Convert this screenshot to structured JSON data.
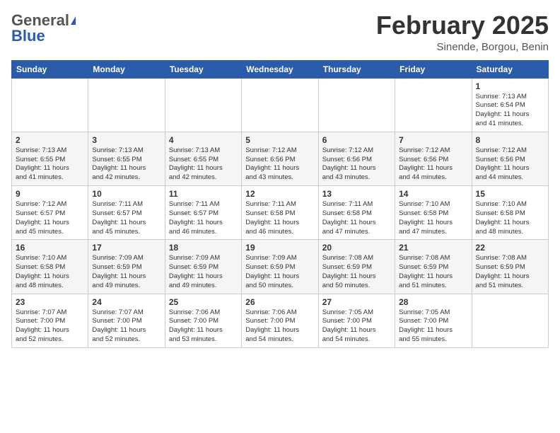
{
  "header": {
    "logo_general": "General",
    "logo_blue": "Blue",
    "month_title": "February 2025",
    "location": "Sinende, Borgou, Benin"
  },
  "calendar": {
    "days_of_week": [
      "Sunday",
      "Monday",
      "Tuesday",
      "Wednesday",
      "Thursday",
      "Friday",
      "Saturday"
    ],
    "weeks": [
      [
        {
          "day": "",
          "info": ""
        },
        {
          "day": "",
          "info": ""
        },
        {
          "day": "",
          "info": ""
        },
        {
          "day": "",
          "info": ""
        },
        {
          "day": "",
          "info": ""
        },
        {
          "day": "",
          "info": ""
        },
        {
          "day": "1",
          "info": "Sunrise: 7:13 AM\nSunset: 6:54 PM\nDaylight: 11 hours\nand 41 minutes."
        }
      ],
      [
        {
          "day": "2",
          "info": "Sunrise: 7:13 AM\nSunset: 6:55 PM\nDaylight: 11 hours\nand 41 minutes."
        },
        {
          "day": "3",
          "info": "Sunrise: 7:13 AM\nSunset: 6:55 PM\nDaylight: 11 hours\nand 42 minutes."
        },
        {
          "day": "4",
          "info": "Sunrise: 7:13 AM\nSunset: 6:55 PM\nDaylight: 11 hours\nand 42 minutes."
        },
        {
          "day": "5",
          "info": "Sunrise: 7:12 AM\nSunset: 6:56 PM\nDaylight: 11 hours\nand 43 minutes."
        },
        {
          "day": "6",
          "info": "Sunrise: 7:12 AM\nSunset: 6:56 PM\nDaylight: 11 hours\nand 43 minutes."
        },
        {
          "day": "7",
          "info": "Sunrise: 7:12 AM\nSunset: 6:56 PM\nDaylight: 11 hours\nand 44 minutes."
        },
        {
          "day": "8",
          "info": "Sunrise: 7:12 AM\nSunset: 6:56 PM\nDaylight: 11 hours\nand 44 minutes."
        }
      ],
      [
        {
          "day": "9",
          "info": "Sunrise: 7:12 AM\nSunset: 6:57 PM\nDaylight: 11 hours\nand 45 minutes."
        },
        {
          "day": "10",
          "info": "Sunrise: 7:11 AM\nSunset: 6:57 PM\nDaylight: 11 hours\nand 45 minutes."
        },
        {
          "day": "11",
          "info": "Sunrise: 7:11 AM\nSunset: 6:57 PM\nDaylight: 11 hours\nand 46 minutes."
        },
        {
          "day": "12",
          "info": "Sunrise: 7:11 AM\nSunset: 6:58 PM\nDaylight: 11 hours\nand 46 minutes."
        },
        {
          "day": "13",
          "info": "Sunrise: 7:11 AM\nSunset: 6:58 PM\nDaylight: 11 hours\nand 47 minutes."
        },
        {
          "day": "14",
          "info": "Sunrise: 7:10 AM\nSunset: 6:58 PM\nDaylight: 11 hours\nand 47 minutes."
        },
        {
          "day": "15",
          "info": "Sunrise: 7:10 AM\nSunset: 6:58 PM\nDaylight: 11 hours\nand 48 minutes."
        }
      ],
      [
        {
          "day": "16",
          "info": "Sunrise: 7:10 AM\nSunset: 6:58 PM\nDaylight: 11 hours\nand 48 minutes."
        },
        {
          "day": "17",
          "info": "Sunrise: 7:09 AM\nSunset: 6:59 PM\nDaylight: 11 hours\nand 49 minutes."
        },
        {
          "day": "18",
          "info": "Sunrise: 7:09 AM\nSunset: 6:59 PM\nDaylight: 11 hours\nand 49 minutes."
        },
        {
          "day": "19",
          "info": "Sunrise: 7:09 AM\nSunset: 6:59 PM\nDaylight: 11 hours\nand 50 minutes."
        },
        {
          "day": "20",
          "info": "Sunrise: 7:08 AM\nSunset: 6:59 PM\nDaylight: 11 hours\nand 50 minutes."
        },
        {
          "day": "21",
          "info": "Sunrise: 7:08 AM\nSunset: 6:59 PM\nDaylight: 11 hours\nand 51 minutes."
        },
        {
          "day": "22",
          "info": "Sunrise: 7:08 AM\nSunset: 6:59 PM\nDaylight: 11 hours\nand 51 minutes."
        }
      ],
      [
        {
          "day": "23",
          "info": "Sunrise: 7:07 AM\nSunset: 7:00 PM\nDaylight: 11 hours\nand 52 minutes."
        },
        {
          "day": "24",
          "info": "Sunrise: 7:07 AM\nSunset: 7:00 PM\nDaylight: 11 hours\nand 52 minutes."
        },
        {
          "day": "25",
          "info": "Sunrise: 7:06 AM\nSunset: 7:00 PM\nDaylight: 11 hours\nand 53 minutes."
        },
        {
          "day": "26",
          "info": "Sunrise: 7:06 AM\nSunset: 7:00 PM\nDaylight: 11 hours\nand 54 minutes."
        },
        {
          "day": "27",
          "info": "Sunrise: 7:05 AM\nSunset: 7:00 PM\nDaylight: 11 hours\nand 54 minutes."
        },
        {
          "day": "28",
          "info": "Sunrise: 7:05 AM\nSunset: 7:00 PM\nDaylight: 11 hours\nand 55 minutes."
        },
        {
          "day": "",
          "info": ""
        }
      ]
    ]
  }
}
